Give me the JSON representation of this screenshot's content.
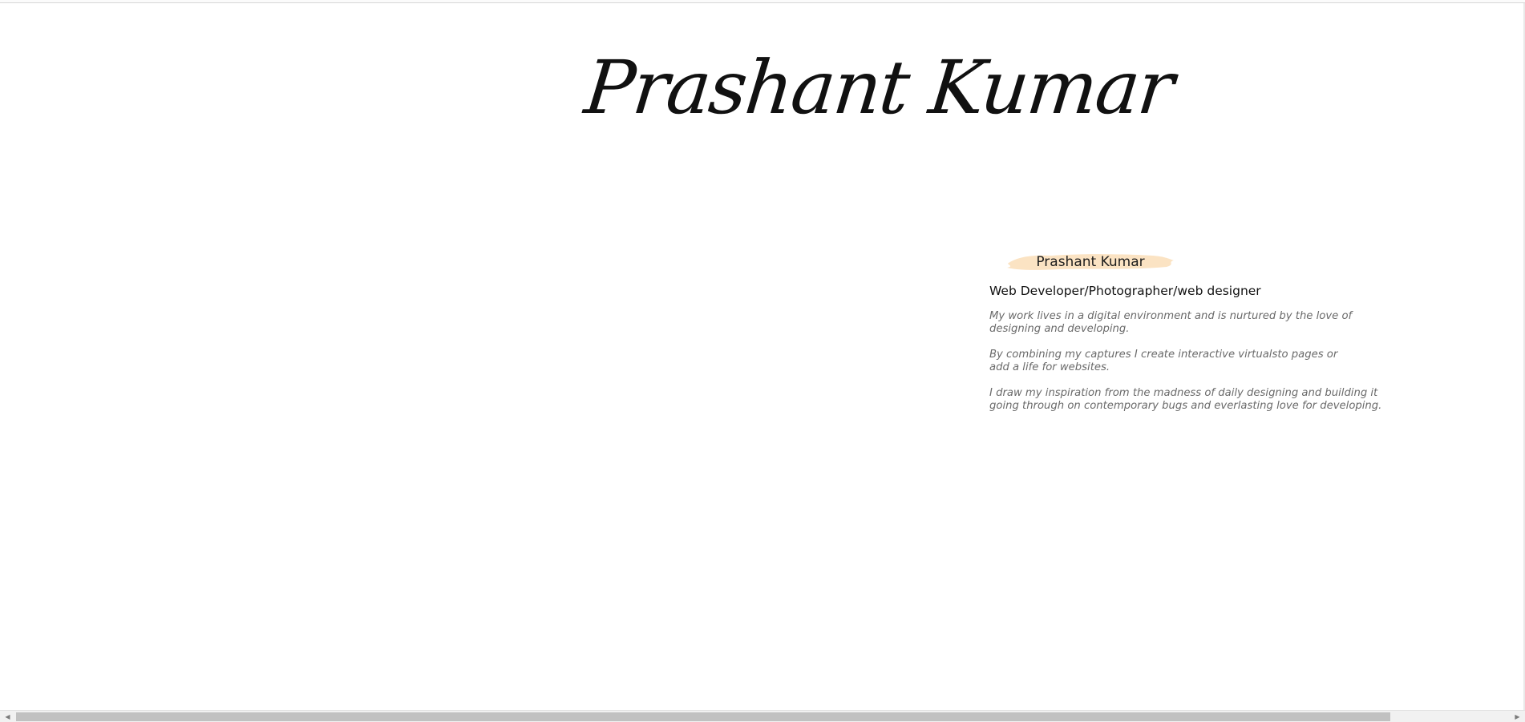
{
  "hero": {
    "title": "Prashant Kumar"
  },
  "about": {
    "badge_name": "Prashant Kumar",
    "badge_color": "#fbe3c3",
    "role": "Web Developer/Photographer/web designer",
    "paragraphs": [
      "My work lives in a digital environment and is nurtured by the love of\ndesigning and developing.",
      "By combining my captures I create interactive virtualsto pages or\nadd a life for websites.",
      "I draw my inspiration from the madness of daily designing and building it\ngoing through on contemporary bugs and everlasting love for developing."
    ]
  },
  "scrollbar": {
    "left_arrow_icon": "chevron-left-icon",
    "right_arrow_icon": "chevron-right-icon"
  }
}
